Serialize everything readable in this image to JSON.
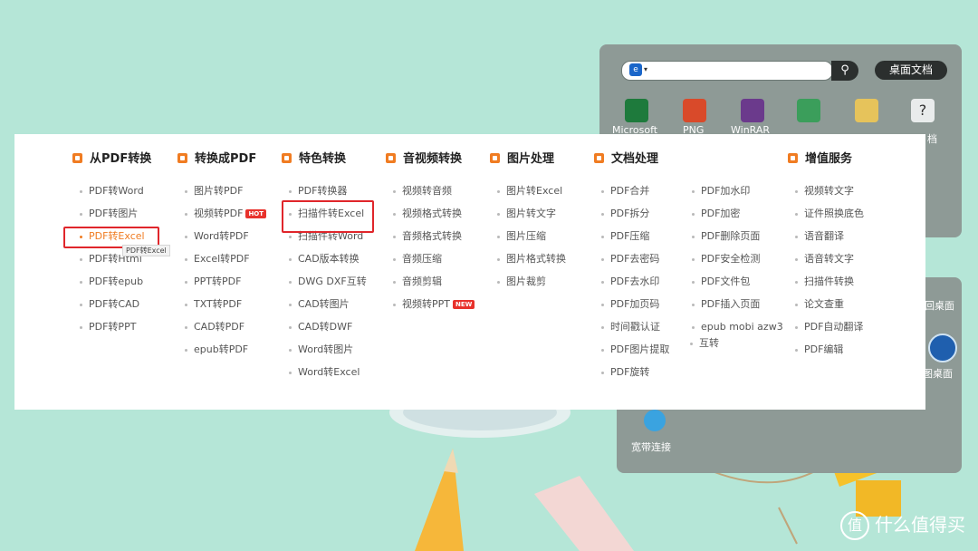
{
  "desktop_widget": {
    "desk_button_label": "桌面文档",
    "icon_labels": [
      "Microsoft",
      "PNG",
      "WinRAR",
      "",
      "",
      "档"
    ],
    "right_labels": [
      "回桌面",
      "图桌面"
    ],
    "bottom_label": "宽带连接"
  },
  "menu": {
    "columns": [
      {
        "title": "从PDF转换",
        "items": [
          "PDF转Word",
          "PDF转图片",
          "PDF转Excel",
          "PDF转Html",
          "PDF转epub",
          "PDF转CAD",
          "PDF转PPT"
        ]
      },
      {
        "title": "转换成PDF",
        "items": [
          "图片转PDF",
          "视频转PDF",
          "Word转PDF",
          "Excel转PDF",
          "PPT转PDF",
          "TXT转PDF",
          "CAD转PDF",
          "epub转PDF"
        ]
      },
      {
        "title": "特色转换",
        "items": [
          "PDF转换器",
          "扫描件转Excel",
          "扫描件转Word",
          "CAD版本转换",
          "DWG DXF互转",
          "CAD转图片",
          "CAD转DWF",
          "Word转图片",
          "Word转Excel"
        ]
      },
      {
        "title": "音视频转换",
        "items": [
          "视频转音频",
          "视频格式转换",
          "音频格式转换",
          "音频压缩",
          "音频剪辑",
          "视频转PPT"
        ]
      },
      {
        "title": "图片处理",
        "items": [
          "图片转Excel",
          "图片转文字",
          "图片压缩",
          "图片格式转换",
          "图片裁剪"
        ]
      },
      {
        "title": "文档处理",
        "items": [
          "PDF合并",
          "PDF拆分",
          "PDF压缩",
          "PDF去密码",
          "PDF去水印",
          "PDF加页码",
          "时间戳认证",
          "PDF图片提取",
          "PDF旋转"
        ]
      },
      {
        "title": "",
        "items": [
          "PDF加水印",
          "PDF加密",
          "PDF删除页面",
          "PDF安全检测",
          "PDF文件包",
          "PDF插入页面",
          "epub mobi azw3",
          "互转"
        ]
      },
      {
        "title": "增值服务",
        "items": [
          "视频转文字",
          "证件照换底色",
          "语音翻译",
          "语音转文字",
          "扫描件转换",
          "论文查重",
          "PDF自动翻译",
          "PDF编辑"
        ]
      }
    ],
    "badges": {
      "hot": "HOT",
      "new": "NEW"
    },
    "tooltip": "PDF转Excel"
  },
  "watermark": {
    "text": "什么值得买",
    "logo": "值"
  }
}
